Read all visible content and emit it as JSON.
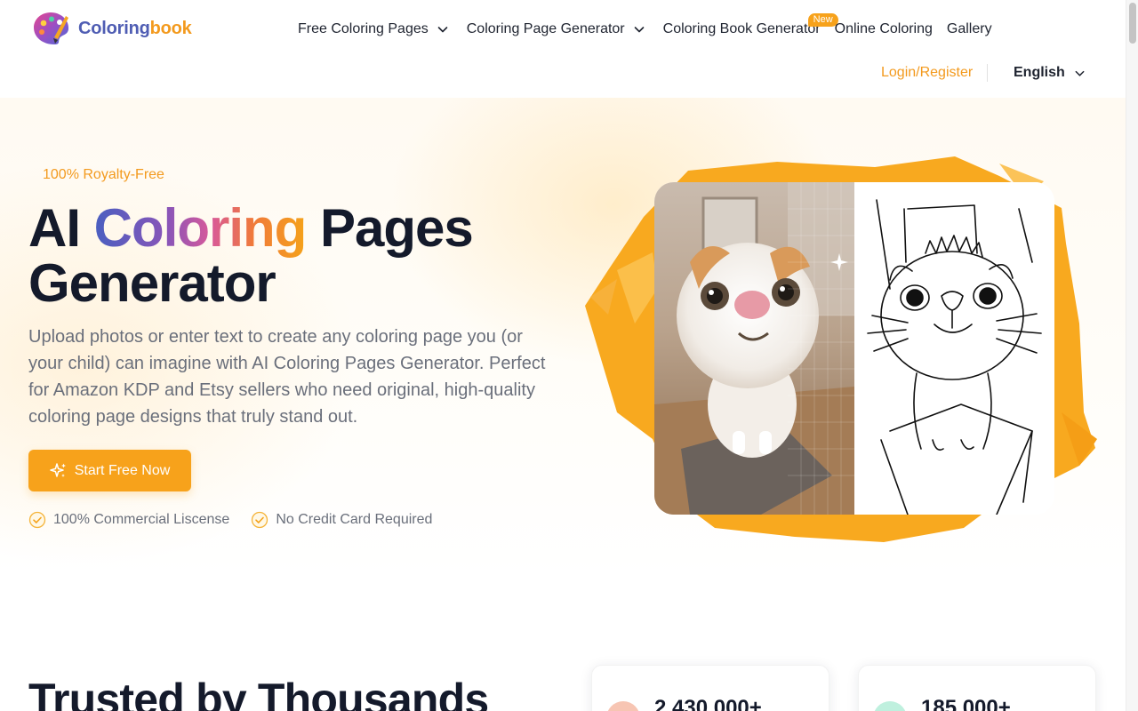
{
  "brand": {
    "name_part1": "Coloring",
    "name_part2": "book"
  },
  "nav": {
    "items": [
      {
        "label": "Free Coloring Pages",
        "has_dropdown": true
      },
      {
        "label": "Coloring Page Generator",
        "has_dropdown": true
      },
      {
        "label": "Coloring Book Generator",
        "badge": "New"
      },
      {
        "label": "Online Coloring"
      },
      {
        "label": "Gallery"
      }
    ],
    "login_label": "Login/Register",
    "language": "English"
  },
  "hero": {
    "eyebrow": "100% Royalty-Free",
    "title_pre": "AI ",
    "title_highlight": "Coloring",
    "title_post": " Pages Generator",
    "description": "Upload photos or enter text to create any coloring page you (or your child) can imagine with AI Coloring Pages Generator. Perfect for Amazon KDP and Etsy sellers who need original, high-quality coloring page designs that truly stand out.",
    "cta_label": "Start Free Now",
    "checks": [
      "100% Commercial Liscense",
      "No Credit Card Required"
    ]
  },
  "trusted": {
    "heading": "Trusted by Thousands",
    "stats": [
      "2,430,000+",
      "185,000+"
    ]
  },
  "colors": {
    "accent": "#f7a21b",
    "accent_text": "#f39a1e",
    "heading": "#141a2b",
    "body_text": "#6a6f7b",
    "brand_blue": "#4f5db3"
  },
  "icons": [
    "palette-logo-icon",
    "chevron-down-icon",
    "sparkle-icon",
    "check-circle-icon"
  ]
}
